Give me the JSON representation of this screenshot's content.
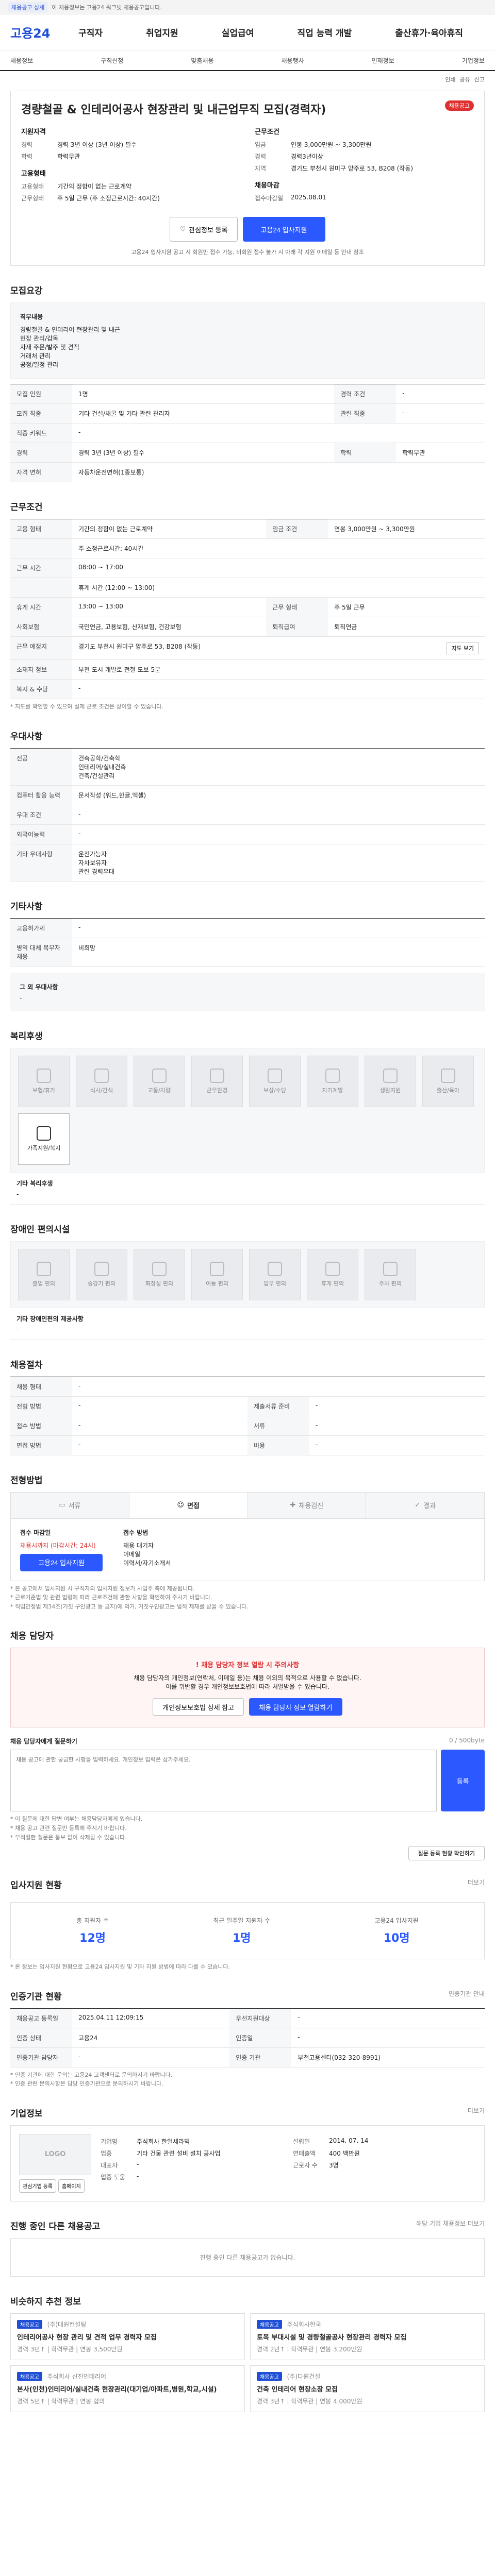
{
  "topbar": {
    "badge": "채용공고 상세",
    "text": "이 채용정보는 고용24 워크넷 채용공고입니다."
  },
  "header": {
    "logo": "고용24",
    "gnb": [
      "구직자",
      "취업지원",
      "실업급여",
      "직업 능력 개발",
      "출산휴가·육아휴직"
    ]
  },
  "subnav": [
    "채용정보",
    "구직신청",
    "맞춤채용",
    "채용행사",
    "인재정보",
    "기업정보"
  ],
  "util": [
    "인쇄",
    "공유",
    "신고"
  ],
  "job": {
    "tag": "채용공고",
    "title": "경량철골 & 인테리어공사 현장관리 및 내근업무직 모집(경력자)",
    "left_heading": "지원자격",
    "left": [
      {
        "k": "경력",
        "v": "경력 3년 이상 (3년 이상) 필수"
      },
      {
        "k": "학력",
        "v": "학력무관"
      }
    ],
    "left_heading2": "고용형태",
    "left2": [
      {
        "k": "고용형태",
        "v": "기간의 정함이 없는 근로계약"
      },
      {
        "k": "근무형태",
        "v": "주 5일 근무 (주 소정근로시간: 40시간)"
      }
    ],
    "right_heading": "근무조건",
    "right": [
      {
        "k": "임금",
        "v": "연봉 3,000만원 ~ 3,300만원"
      },
      {
        "k": "경력",
        "v": "경력3년이상"
      },
      {
        "k": "지역",
        "v": "경기도 부천시 원미구 양주로 53, B208 (작동)"
      }
    ],
    "right_heading2": "채용마감",
    "right2": [
      {
        "k": "접수마감일",
        "v": "2025.08.01"
      }
    ],
    "btn_scrap": "관심정보 등록",
    "btn_apply": "고용24 입사지원",
    "btn_notice": "고용24 입사지원 공고 시 회원만 접수 가능, 비회원 접수 불가 시 아래 각 지원 이메일 등 안내 참조"
  },
  "recruit": {
    "title": "모집요강",
    "job_desc_label": "직무내용",
    "job_desc": [
      "경량철골 & 인테리어 현장관리 및 내근",
      "현장 관리/감독",
      "자재 주문/발주 및 견적",
      "거래처 관리",
      "공정/일정 관리"
    ],
    "rows": [
      {
        "k": "모집 인원",
        "v": "1명",
        "k2": "경력 조건",
        "v2": "-"
      },
      {
        "k": "모집 직종",
        "v": "기타 건설/채굴 및 기타 관련 관리자",
        "k2": "관련 직종",
        "v2": "-"
      },
      {
        "k": "직종 키워드",
        "v": "-",
        "k2": "",
        "v2": ""
      },
      {
        "k": "경력",
        "v": "경력 3년 (3년 이상) 필수",
        "k2": "학력",
        "v2": "학력무관"
      },
      {
        "k": "자격 면허",
        "v": "자동차운전면허(1종보통)"
      }
    ]
  },
  "work": {
    "title": "근무조건",
    "rows": [
      {
        "k": "고용 형태",
        "v": "기간의 정함이 없는 근로계약",
        "k2": "임금 조건",
        "v2": "연봉 3,000만원 ~ 3,300만원"
      },
      {
        "k": "",
        "v": "주 소정근로시간: 40시간",
        "k2": "",
        "v2": ""
      },
      {
        "k": "근무 시간",
        "v": "08:00 ~ 17:00",
        "k2": "",
        "v2": ""
      },
      {
        "k": "",
        "v": "휴게 시간 (12:00 ~ 13:00)",
        "k2": "",
        "v2": ""
      },
      {
        "k": "휴게 시간",
        "v": "13:00 ~ 13:00",
        "k2": "근무 형태",
        "v2": "주 5일 근무"
      },
      {
        "k": "사회보험",
        "v": "국민연금, 고용보험, 산재보험, 건강보험",
        "k2": "퇴직급여",
        "v2": "퇴직연금"
      },
      {
        "k": "근무 예정지",
        "v": "경기도 부천시 원미구 양주로 53, B208 (작동)",
        "k2": "",
        "v2": ""
      },
      {
        "k": "소재지 정보",
        "v": "부천 도시 개발로 전철 도보 5분",
        "k2": "",
        "v2": ""
      },
      {
        "k": "복지 & 수당",
        "v": "-",
        "k2": "",
        "v2": ""
      }
    ],
    "note": "* 지도를 확인할 수 있으며 실제 근로 조건은 상이할 수 있습니다.",
    "map_button": "지도 보기"
  },
  "welfare_basic": {
    "title": "우대사항",
    "rows": [
      {
        "k": "전공",
        "v": "건축공학/건축학\n인테리어/실내건축\n건축/건설관리"
      },
      {
        "k": "컴퓨터 활용 능력",
        "v": "문서작성 (워드,한글,엑셀)"
      },
      {
        "k": "우대 조건",
        "v": "-"
      },
      {
        "k": "외국어능력",
        "v": "-"
      },
      {
        "k": "기타 우대사항",
        "v": "운전가능자\n자차보유자\n관련 경력우대"
      }
    ]
  },
  "etc": {
    "title": "기타사항",
    "rows": [
      {
        "k": "고용허가제",
        "v": "-"
      },
      {
        "k": "병역 대체 복무자 채용",
        "v": "비희망"
      },
      {
        "k": "그 외 우대사항",
        "v": "-"
      }
    ]
  },
  "benefits": {
    "title": "복리후생",
    "icons": [
      {
        "label": "보험/휴가",
        "active": false
      },
      {
        "label": "식사/간식",
        "active": false
      },
      {
        "label": "교통/차량",
        "active": false
      },
      {
        "label": "근무환경",
        "active": false
      },
      {
        "label": "보상/수당",
        "active": false
      },
      {
        "label": "자기계발",
        "active": false
      },
      {
        "label": "생활지원",
        "active": false
      },
      {
        "label": "출산/육아",
        "active": false
      },
      {
        "label": "가족지원/복지",
        "active": true
      }
    ],
    "other_label": "기타 복리후생",
    "other_value": "-"
  },
  "disability": {
    "title": "장애인 편의시설",
    "icons": [
      {
        "label": "출입 편의",
        "active": false
      },
      {
        "label": "승강기 편의",
        "active": false
      },
      {
        "label": "화장실 편의",
        "active": false
      },
      {
        "label": "이동 편의",
        "active": false
      },
      {
        "label": "업무 편의",
        "active": false
      },
      {
        "label": "휴게 편의",
        "active": false
      },
      {
        "label": "주차 편의",
        "active": false
      }
    ],
    "other_label": "기타 장애인편의 제공사항",
    "other_value": "-"
  },
  "process": {
    "title": "채용절차",
    "rows": [
      {
        "k": "채용 형태",
        "v": "-",
        "k2": "",
        "v2": ""
      },
      {
        "k": "전형 방법",
        "v": "-",
        "k2": "제출서류 준비",
        "v2": "-"
      },
      {
        "k": "접수 방법",
        "v": "-",
        "k2": "서류",
        "v2": "-"
      },
      {
        "k": "면접 방법",
        "v": "-",
        "k2": "비용",
        "v2": "-"
      }
    ]
  },
  "apply": {
    "title": "전형방법",
    "tabs": [
      {
        "label": "서류",
        "active": false
      },
      {
        "label": "면접",
        "active": true
      },
      {
        "label": "채용검진",
        "active": false
      },
      {
        "label": "결과",
        "active": false
      }
    ],
    "left_label": "접수 마감일",
    "left_value": "채용시까지 (마감시간: 24시)",
    "left_button": "고용24 입사지원",
    "right_label": "접수 방법",
    "right_list": [
      "채용 대기자",
      "이메일",
      "이력서/자기소개서"
    ],
    "notes": [
      "* 본 공고에서 입사지원 시 구직자의 입사지원 정보가 사업주 측에 제공됩니다.",
      "* 근로기준법 및 관련 법령에 따라 근로조건에 관한 사항을 확인하여 주시기 바랍니다.",
      "* 직업안정법 제34조(거짓 구인광고 등 금지)에 의거, 거짓구인광고는 법적 제재를 받을 수 있습니다."
    ]
  },
  "contact": {
    "title": "채용 담당자",
    "alert_title": "! 채용 담당자 정보 열람 시 주의사항",
    "alert_lines": [
      "채용 담당자의 개인정보(연락처, 이메일 등)는 채용 이외의 목적으로 사용할 수 없습니다.",
      "이를 위반할 경우 개인정보보호법에 따라 처벌받을 수 있습니다."
    ],
    "btn_hide": "개인정보보호법 상세 참고",
    "btn_show": "채용 담당자 정보 열람하기",
    "inquiry_label": "채용 담당자에게 질문하기",
    "inquiry_count": "0 / 500byte",
    "inquiry_placeholder": "채용 공고에 관한 궁금한 사항을 입력하세요. 개인정보 입력은 삼가주세요.",
    "inquiry_btn": "등록",
    "notes": [
      "* 이 질문에 대한 답변 여부는 채용담당자에게 있습니다.",
      "* 채용 공고 관련 질문만 등록해 주시기 바랍니다.",
      "* 부적절한 질문은 통보 없이 삭제될 수 있습니다."
    ],
    "status_btn": "질문 등록 현황 확인하기"
  },
  "stats": {
    "title": "입사지원 현황",
    "more": "더보기",
    "items": [
      {
        "label": "총 지원자 수",
        "num": "12명"
      },
      {
        "label": "최근 일주일 지원자 수",
        "num": "1명"
      },
      {
        "label": "고용24 입사지원",
        "num": "10명"
      }
    ],
    "note": "* 본 정보는 입사지원 현황으로 고용24 입사지원 및 기타 지원 방법에 따라 다를 수 있습니다."
  },
  "agency": {
    "title": "인증기관 현황",
    "more": "인증기관 안내",
    "rows": [
      {
        "k": "채용공고 등록일",
        "v": "2025.04.11 12:09:15",
        "k2": "우선지원대상",
        "v2": "-"
      },
      {
        "k": "인증 상태",
        "v": "고용24",
        "k2": "인증일",
        "v2": "-"
      },
      {
        "k": "인증기관 담당자",
        "v": "-",
        "k2": "인증 기관",
        "v2": "부천고용센터(032-320-8991)"
      }
    ],
    "notes": [
      "* 인증 기관에 대한 문의는 고용24 고객센터로 문의하시기 바랍니다.",
      "* 인증 관련 문의사항은 담당 인증기관으로 문의하시기 바랍니다."
    ]
  },
  "company": {
    "title": "기업정보",
    "more": "더보기",
    "logo_text": "LOGO",
    "left": [
      {
        "k": "기업명",
        "v": "주식회사 한일세라믹"
      },
      {
        "k": "업종",
        "v": "기타 건물 관련 설비 설치 공사업"
      },
      {
        "k": "대표자",
        "v": "-"
      },
      {
        "k": "업종 도움",
        "v": "-"
      }
    ],
    "right": [
      {
        "k": "설립일",
        "v": "2014. 07. 14"
      },
      {
        "k": "연매출액",
        "v": "400 백만원"
      },
      {
        "k": "근로자 수",
        "v": "3명"
      }
    ],
    "btn_interest": "관심기업 등록",
    "btn_homepage": "홈페이지"
  },
  "more_jobs": {
    "title": "진행 중인 다른 채용공고",
    "more": "해당 기업 채용정보 더보기",
    "empty": "진행 중인 다른 채용공고가 없습니다."
  },
  "related": {
    "title": "비슷하지 추천 정보",
    "jobs": [
      {
        "company": "(주)대원컨설팅",
        "pill": "채용공고",
        "title": "인테리어공사 현장 관리 및 견적 업무 경력자 모집",
        "detail": "경력 3년↑ | 학력무관 | 연봉 3,500만원"
      },
      {
        "company": "주식회사한국",
        "pill": "채용공고",
        "title": "토목 부대시설 및 경량철골공사 현장관리 경력자 모집",
        "detail": "경력 2년↑ | 학력무관 | 연봉 3,200만원"
      },
      {
        "company": "주식회사 신진인테리어",
        "pill": "채용공고",
        "title": "본사(인천)인테리어/실내건축 현장관리(대기업/아파트,병원,학교,시설)",
        "detail": "경력 5년↑ | 학력무관 | 연봉 협의"
      },
      {
        "company": "(주)다원건설",
        "pill": "채용공고",
        "title": "건축 인테리어 현장소장 모집",
        "detail": "경력 3년↑ | 학력무관 | 연봉 4,000만원"
      }
    ]
  }
}
